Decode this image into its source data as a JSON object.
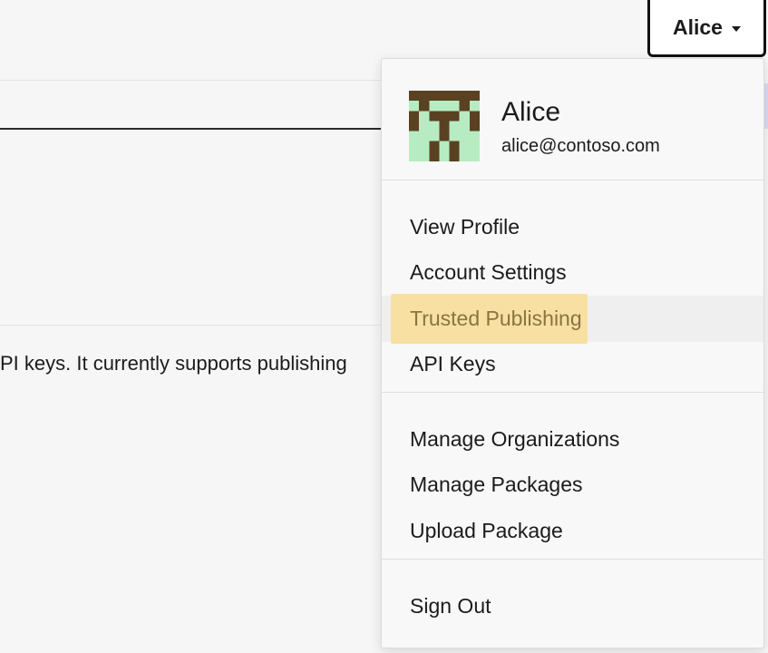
{
  "background": {
    "description_text": "PI keys. It currently supports publishing"
  },
  "user_menu": {
    "trigger_label": "Alice",
    "profile": {
      "name": "Alice",
      "email": "alice@contoso.com"
    },
    "groups": [
      {
        "items": [
          {
            "label": "View Profile"
          },
          {
            "label": "Account Settings"
          },
          {
            "label": "Trusted Publishing",
            "highlighted": true
          },
          {
            "label": "API Keys"
          }
        ]
      },
      {
        "items": [
          {
            "label": "Manage Organizations"
          },
          {
            "label": "Manage Packages"
          },
          {
            "label": "Upload Package"
          }
        ]
      },
      {
        "items": [
          {
            "label": "Sign Out"
          }
        ]
      }
    ]
  },
  "colors": {
    "highlight_bg": "#f7e0a2",
    "highlight_text": "#8a7440",
    "avatar_dark": "#5a4122",
    "avatar_light": "#b7ecc2"
  },
  "icons": {
    "trigger_caret": "caret-down-icon",
    "avatar": "identicon-avatar"
  }
}
